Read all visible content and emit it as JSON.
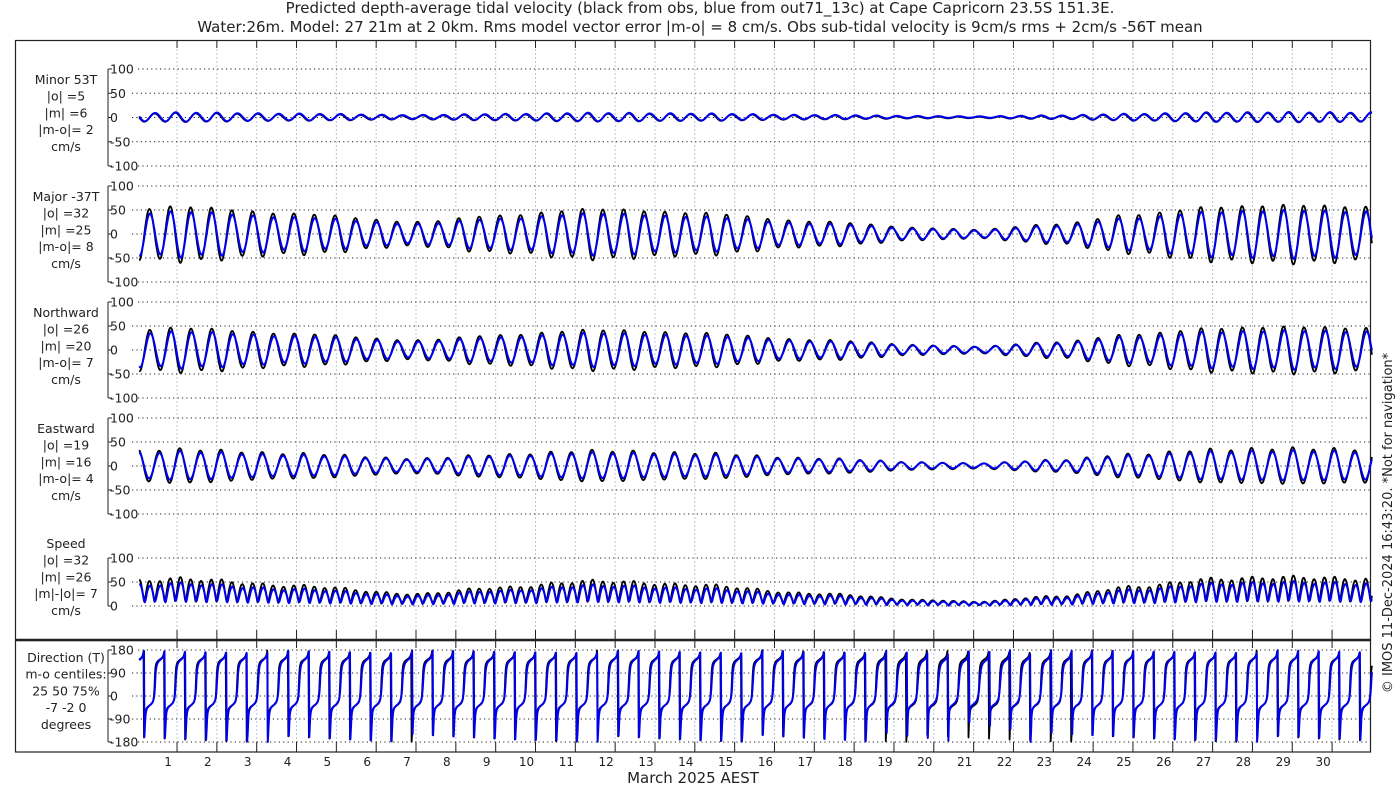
{
  "title": {
    "line1": "Predicted depth-average tidal velocity (black from obs, blue from out71_13c) at Cape Capricorn 23.5S 151.3E.",
    "line2": "Water:26m. Model: 27 21m at 2 0km. Rms model vector error |m-o| = 8 cm/s. Obs sub-tidal velocity is 9cm/s rms + 2cm/s -56T mean"
  },
  "xlabel": "March 2025 AEST",
  "credit": "© IMOS 11-Dec-2024 16:43:20. *Not for navigation*",
  "colors": {
    "obs": "#000000",
    "model": "#0000ee"
  },
  "chart_data": {
    "type": "line",
    "x_unit": "day of March 2025",
    "xlim": [
      0,
      31
    ],
    "x_ticks": [
      "1",
      "2",
      "3",
      "4",
      "5",
      "6",
      "7",
      "8",
      "9",
      "10",
      "11",
      "12",
      "13",
      "14",
      "15",
      "16",
      "17",
      "18",
      "19",
      "20",
      "21",
      "22",
      "23",
      "24",
      "25",
      "26",
      "27",
      "28",
      "29",
      "30"
    ],
    "tidal_period_days": 0.5175,
    "major_axis_deg_true": -37,
    "minor_axis_deg_true": 53,
    "minor_ratio": {
      "obs": 0.16,
      "model": 0.2
    },
    "envelope_obs": [
      [
        0,
        52
      ],
      [
        1,
        57
      ],
      [
        4,
        42
      ],
      [
        7,
        25
      ],
      [
        9,
        38
      ],
      [
        11.5,
        52
      ],
      [
        14,
        44
      ],
      [
        17,
        26
      ],
      [
        20,
        12
      ],
      [
        21,
        9
      ],
      [
        23,
        20
      ],
      [
        25,
        40
      ],
      [
        27,
        56
      ],
      [
        29,
        60
      ],
      [
        31,
        56
      ]
    ],
    "model_scale": 0.82,
    "model_phase_lag_days": 0.012,
    "panels": [
      {
        "key": "minor",
        "label": [
          "Minor 53T",
          "|o| =5",
          "|m| =6",
          "|m-o|= 2",
          "cm/s"
        ],
        "ylim": [
          -100,
          100
        ],
        "ticks": [
          "100",
          "50",
          "0",
          "-50",
          "-100"
        ],
        "tick_values": [
          100,
          50,
          0,
          -50,
          -100
        ]
      },
      {
        "key": "major",
        "label": [
          "Major -37T",
          "|o| =32",
          "|m| =25",
          "|m-o|= 8",
          "cm/s"
        ],
        "ylim": [
          -100,
          100
        ],
        "ticks": [
          "100",
          "50",
          "0",
          "-50",
          "-100"
        ],
        "tick_values": [
          100,
          50,
          0,
          -50,
          -100
        ]
      },
      {
        "key": "north",
        "label": [
          "Northward",
          "|o| =26",
          "|m| =20",
          "|m-o|= 7",
          "cm/s"
        ],
        "ylim": [
          -100,
          100
        ],
        "ticks": [
          "100",
          "50",
          "0",
          "-50",
          "-100"
        ],
        "tick_values": [
          100,
          50,
          0,
          -50,
          -100
        ]
      },
      {
        "key": "east",
        "label": [
          "Eastward",
          "|o| =19",
          "|m| =16",
          "|m-o|= 4",
          "cm/s"
        ],
        "ylim": [
          -100,
          100
        ],
        "ticks": [
          "100",
          "50",
          "0",
          "-50",
          "-100"
        ],
        "tick_values": [
          100,
          50,
          0,
          -50,
          -100
        ]
      },
      {
        "key": "speed",
        "label": [
          "Speed",
          "|o| =32",
          "|m| =26",
          "|m|-|o|= 7",
          "cm/s"
        ],
        "ylim": [
          0,
          100
        ],
        "ticks": [
          "100",
          "50",
          "0"
        ],
        "tick_values": [
          100,
          50,
          0
        ]
      },
      {
        "key": "dir",
        "label": [
          "Direction (T)",
          "m-o centiles:",
          "25  50  75%",
          "-7 -2  0",
          "degrees"
        ],
        "ylim": [
          -180,
          180
        ],
        "ticks": [
          "180",
          "90",
          "0",
          "-90",
          "-180"
        ],
        "tick_values": [
          180,
          90,
          0,
          -90,
          -180
        ]
      }
    ]
  }
}
